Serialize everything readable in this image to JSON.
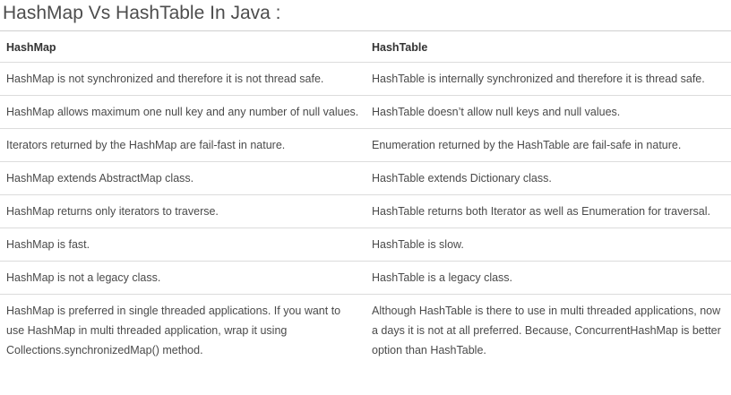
{
  "page": {
    "title": "HashMap Vs HashTable In Java :"
  },
  "table": {
    "headers": [
      "HashMap",
      "HashTable"
    ],
    "rows": [
      [
        "HashMap is not synchronized and therefore it is not thread safe.",
        "HashTable is internally synchronized and therefore it is thread safe."
      ],
      [
        "HashMap allows maximum one null key and any number of null values.",
        "HashTable doesn’t allow null keys and null values."
      ],
      [
        "Iterators returned by the HashMap are fail-fast in nature.",
        "Enumeration returned by the HashTable are fail-safe in nature."
      ],
      [
        "HashMap extends AbstractMap class.",
        "HashTable extends Dictionary class."
      ],
      [
        "HashMap returns only iterators to traverse.",
        "HashTable returns both Iterator as well as Enumeration for traversal."
      ],
      [
        "HashMap is fast.",
        "HashTable is slow."
      ],
      [
        "HashMap is not a legacy class.",
        "HashTable is a legacy class."
      ],
      [
        "HashMap is preferred in single threaded applications. If you want to use HashMap in multi threaded application, wrap it using Collections.synchronizedMap() method.",
        "Although HashTable is there to use in multi threaded applications, now a days it is not at all preferred. Because, ConcurrentHashMap is better option than HashTable."
      ]
    ]
  }
}
